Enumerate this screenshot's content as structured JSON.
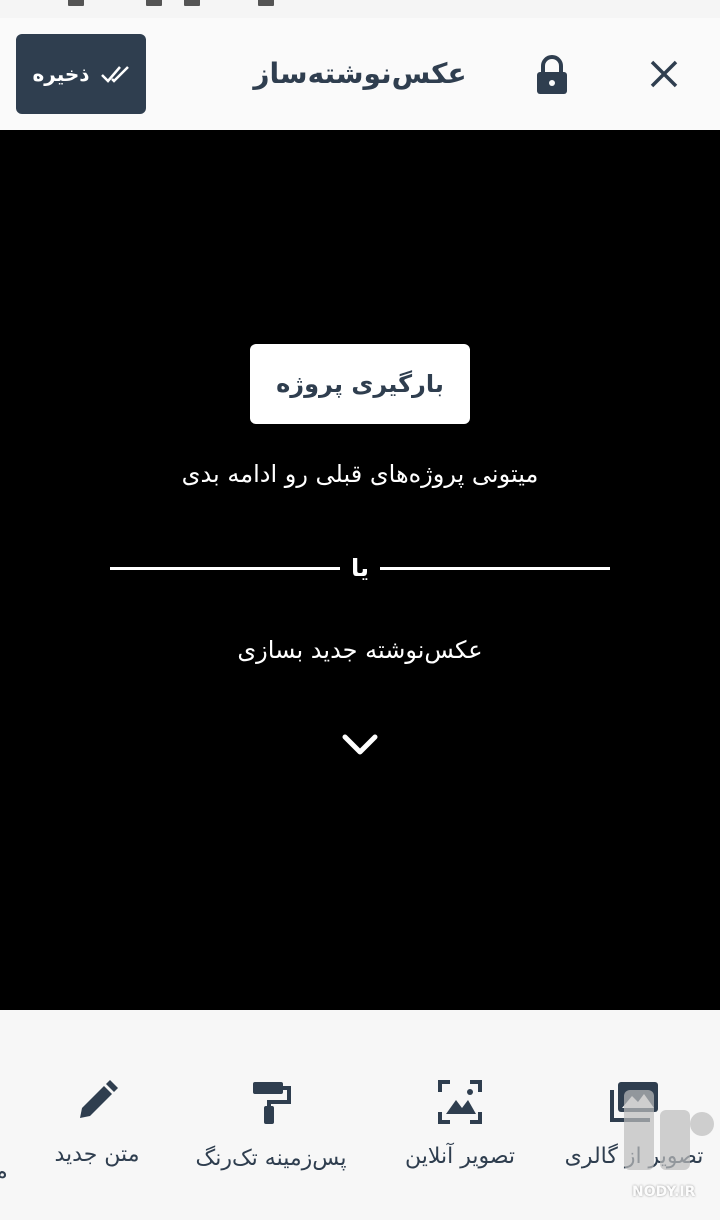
{
  "header": {
    "title": "عکس‌نوشته‌ساز",
    "save_label": "ذخیره",
    "save_icon": "double-check-icon",
    "lock_icon": "lock-icon",
    "close_icon": "close-icon"
  },
  "main": {
    "load_button": "بارگیری پروژه",
    "continue_text": "میتونی پروژه‌های قبلی رو ادامه بدی",
    "or_text": "یا",
    "new_text": "عکس‌نوشته جدید بسازی",
    "chevron_icon": "chevron-down-icon"
  },
  "toolbar": {
    "items": [
      {
        "label": "تصویر از گالری",
        "icon": "gallery-icon"
      },
      {
        "label": "تصویر آنلاین",
        "icon": "online-image-icon"
      },
      {
        "label": "پس‌زمینه تک‌رنگ",
        "icon": "paint-roller-icon"
      },
      {
        "label": "متن جدید",
        "icon": "pencil-icon"
      }
    ]
  },
  "watermark": {
    "text": "NODY.IR"
  },
  "colors": {
    "accent": "#2f3e4f",
    "background": "#000000",
    "header": "#fafafa"
  }
}
